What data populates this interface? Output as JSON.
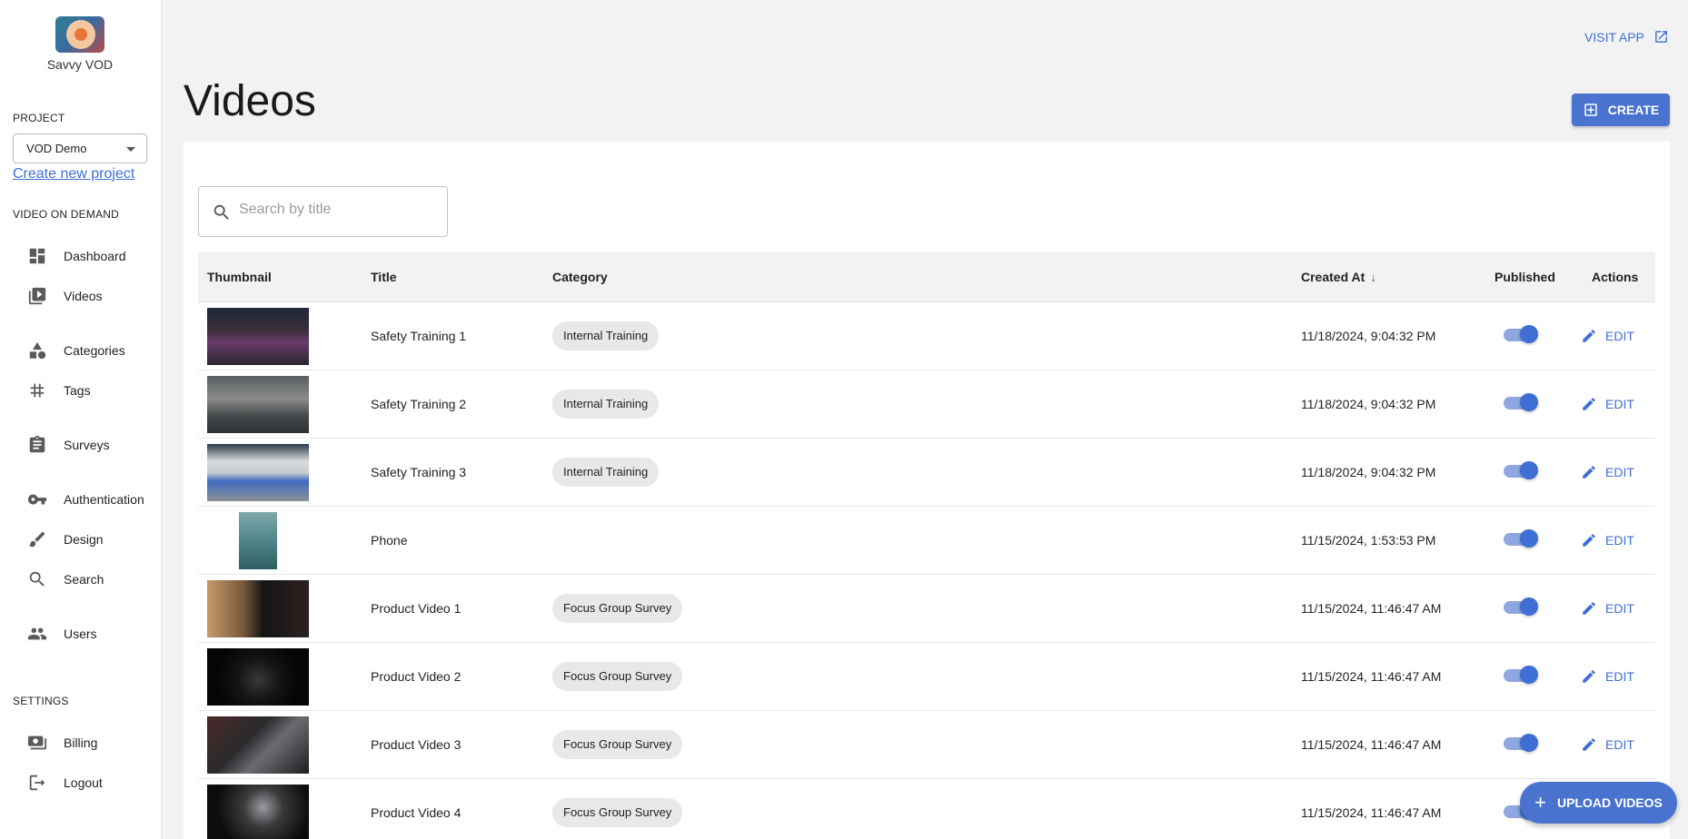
{
  "sidebar": {
    "brand": "Savvy VOD",
    "project_label": "PROJECT",
    "project_selected": "VOD Demo",
    "create_project": "Create new project",
    "vod_label": "VIDEO ON DEMAND",
    "items": [
      {
        "label": "Dashboard",
        "icon": "dashboard-icon"
      },
      {
        "label": "Videos",
        "icon": "videos-icon"
      },
      {
        "label": "Categories",
        "icon": "categories-icon"
      },
      {
        "label": "Tags",
        "icon": "hash-icon"
      },
      {
        "label": "Surveys",
        "icon": "clipboard-icon"
      },
      {
        "label": "Authentication",
        "icon": "key-icon"
      },
      {
        "label": "Design",
        "icon": "brush-icon"
      },
      {
        "label": "Search",
        "icon": "search-icon"
      },
      {
        "label": "Users",
        "icon": "users-icon"
      }
    ],
    "settings_label": "SETTINGS",
    "settings_items": [
      {
        "label": "Billing",
        "icon": "billing-icon"
      },
      {
        "label": "Logout",
        "icon": "logout-icon"
      }
    ]
  },
  "header": {
    "visit_app": "VISIT APP",
    "title": "Videos",
    "create": "CREATE"
  },
  "search": {
    "placeholder": "Search by title"
  },
  "table": {
    "columns": {
      "thumbnail": "Thumbnail",
      "title": "Title",
      "category": "Category",
      "created_at": "Created At",
      "published": "Published",
      "actions": "Actions"
    },
    "edit_label": "EDIT",
    "rows": [
      {
        "title": "Safety Training 1",
        "category": "Internal Training",
        "created": "11/18/2024, 9:04:32 PM",
        "published": true
      },
      {
        "title": "Safety Training 2",
        "category": "Internal Training",
        "created": "11/18/2024, 9:04:32 PM",
        "published": true
      },
      {
        "title": "Safety Training 3",
        "category": "Internal Training",
        "created": "11/18/2024, 9:04:32 PM",
        "published": true
      },
      {
        "title": "Phone",
        "category": "",
        "created": "11/15/2024, 1:53:53 PM",
        "published": true
      },
      {
        "title": "Product Video 1",
        "category": "Focus Group Survey",
        "created": "11/15/2024, 11:46:47 AM",
        "published": true
      },
      {
        "title": "Product Video 2",
        "category": "Focus Group Survey",
        "created": "11/15/2024, 11:46:47 AM",
        "published": true
      },
      {
        "title": "Product Video 3",
        "category": "Focus Group Survey",
        "created": "11/15/2024, 11:46:47 AM",
        "published": true
      },
      {
        "title": "Product Video 4",
        "category": "Focus Group Survey",
        "created": "11/15/2024, 11:46:47 AM",
        "published": true
      }
    ]
  },
  "upload": "UPLOAD VIDEOS",
  "colors": {
    "accent": "#4a73cf",
    "link": "#3f6fd4"
  }
}
